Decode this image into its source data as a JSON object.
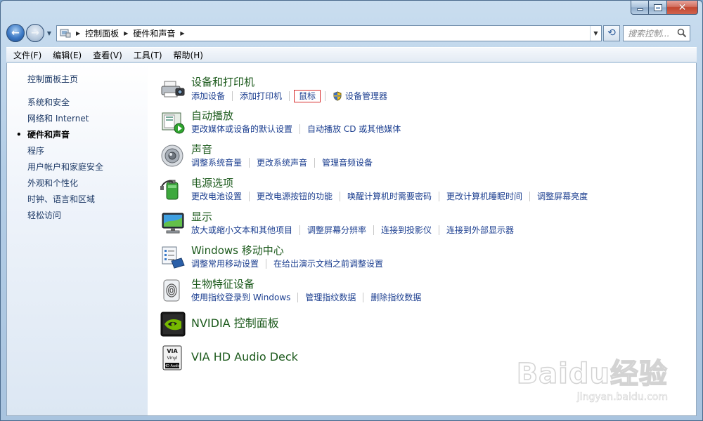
{
  "window": {
    "caption_buttons": {
      "minimize": "minimize-icon",
      "maximize": "maximize-icon",
      "close": "close-icon"
    }
  },
  "address": {
    "breadcrumbs": [
      "控制面板",
      "硬件和声音"
    ]
  },
  "search": {
    "placeholder": "搜索控制..."
  },
  "menu": {
    "items": [
      "文件(F)",
      "编辑(E)",
      "查看(V)",
      "工具(T)",
      "帮助(H)"
    ]
  },
  "sidebar": {
    "home": "控制面板主页",
    "items": [
      "系统和安全",
      "网络和 Internet",
      "硬件和声音",
      "程序",
      "用户帐户和家庭安全",
      "外观和个性化",
      "时钟、语言和区域",
      "轻松访问"
    ],
    "active_index": 2
  },
  "categories": [
    {
      "title": "设备和打印机",
      "icon": "printer-camera-icon",
      "links": [
        "添加设备",
        "添加打印机",
        "鼠标",
        "设备管理器"
      ],
      "boxed_link": "鼠标",
      "shield_link": "设备管理器"
    },
    {
      "title": "自动播放",
      "icon": "autoplay-icon",
      "links": [
        "更改媒体或设备的默认设置",
        "自动播放 CD 或其他媒体"
      ]
    },
    {
      "title": "声音",
      "icon": "speaker-icon",
      "links": [
        "调整系统音量",
        "更改系统声音",
        "管理音频设备"
      ]
    },
    {
      "title": "电源选项",
      "icon": "power-battery-icon",
      "links": [
        "更改电池设置",
        "更改电源按钮的功能",
        "唤醒计算机时需要密码",
        "更改计算机睡眠时间",
        "调整屏幕亮度"
      ]
    },
    {
      "title": "显示",
      "icon": "display-monitor-icon",
      "links": [
        "放大或缩小文本和其他项目",
        "调整屏幕分辨率",
        "连接到投影仪",
        "连接到外部显示器"
      ]
    },
    {
      "title": "Windows 移动中心",
      "icon": "mobility-center-icon",
      "links": [
        "调整常用移动设置",
        "在给出演示文档之前调整设置"
      ]
    },
    {
      "title": "生物特征设备",
      "icon": "fingerprint-icon",
      "links": [
        "使用指纹登录到 Windows",
        "管理指纹数据",
        "删除指纹数据"
      ]
    },
    {
      "title": "NVIDIA 控制面板",
      "icon": "nvidia-logo-icon",
      "links": []
    },
    {
      "title": "VIA HD Audio Deck",
      "icon": "via-audio-icon",
      "links": []
    }
  ],
  "watermark": {
    "main": "Baidu经验",
    "sub": "jingyan.baidu.com"
  }
}
